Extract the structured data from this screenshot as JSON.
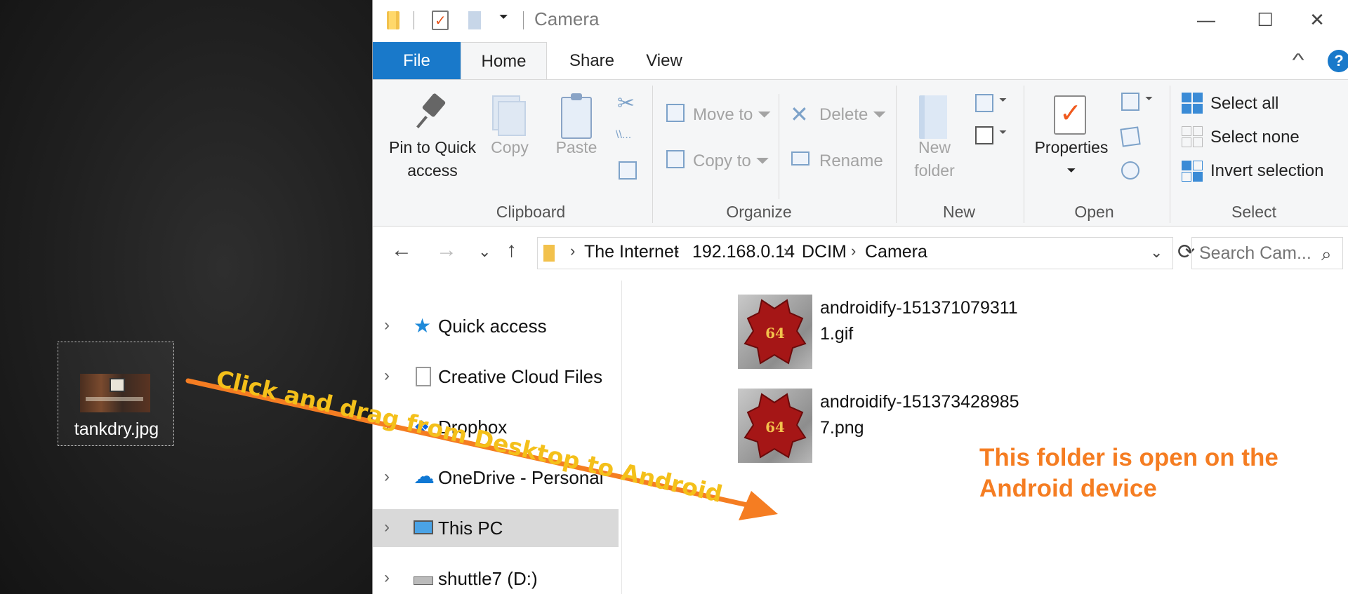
{
  "desktop": {
    "file_label": "tankdry.jpg"
  },
  "window": {
    "title": "Camera",
    "minimize": "—",
    "maximize": "☐",
    "close": "✕"
  },
  "tabs": [
    {
      "label": "File"
    },
    {
      "label": "Home"
    },
    {
      "label": "Share"
    },
    {
      "label": "View"
    }
  ],
  "help": "?",
  "ribbon": {
    "clipboard": {
      "label": "Clipboard",
      "pin": [
        "Pin to Quick",
        "access"
      ],
      "copy": "Copy",
      "paste": "Paste"
    },
    "organize": {
      "label": "Organize",
      "move_to": "Move to",
      "copy_to": "Copy to",
      "delete": "Delete",
      "rename": "Rename"
    },
    "new": {
      "label": "New",
      "new_folder": [
        "New",
        "folder"
      ]
    },
    "open": {
      "label": "Open",
      "properties": "Properties"
    },
    "select": {
      "label": "Select",
      "select_all": "Select all",
      "select_none": "Select none",
      "invert": "Invert selection"
    }
  },
  "address": {
    "crumbs": [
      "The Internet",
      "192.168.0.14",
      "DCIM",
      "Camera"
    ],
    "search_placeholder": "Search Cam..."
  },
  "nav": [
    {
      "label": "Quick access",
      "icon": "star-icon"
    },
    {
      "label": "Creative Cloud Files",
      "icon": "document-icon"
    },
    {
      "label": "Dropbox",
      "icon": "dropbox-icon"
    },
    {
      "label": "OneDrive - Personal",
      "icon": "cloud-icon"
    },
    {
      "label": "This PC",
      "icon": "computer-icon",
      "selected": true
    },
    {
      "label": "shuttle7 (D:)",
      "icon": "drive-icon"
    }
  ],
  "files": [
    {
      "name": "androidify-1513710793111.gif",
      "badge": "64"
    },
    {
      "name": "androidify-1513734289857.png",
      "badge": "64"
    }
  ],
  "annotations": {
    "drag_caption": "Click and drag from Desktop to Android",
    "folder_note": [
      "This folder is open on the",
      "Android device"
    ]
  },
  "colors": {
    "accent": "#1979ca",
    "annotation_orange": "#f57d22",
    "annotation_yellow": "#f4c01a"
  }
}
